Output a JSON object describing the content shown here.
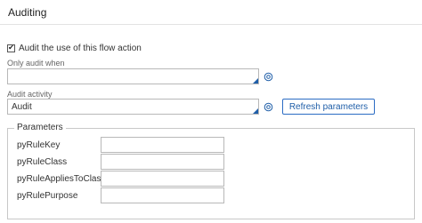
{
  "header": {
    "title": "Auditing"
  },
  "audit_checkbox": {
    "label": "Audit the use of this flow action",
    "checked": true,
    "check_glyph": "✔"
  },
  "only_audit_when": {
    "label": "Only audit when",
    "value": ""
  },
  "audit_activity": {
    "label": "Audit activity",
    "value": "Audit"
  },
  "refresh_button": {
    "label": "Refresh parameters"
  },
  "parameters": {
    "legend": "Parameters",
    "rows": [
      {
        "label": "pyRuleKey",
        "value": ""
      },
      {
        "label": "pyRuleClass",
        "value": ""
      },
      {
        "label": "pyRuleAppliesToClass",
        "value": ""
      },
      {
        "label": "pyRulePurpose",
        "value": ""
      }
    ]
  },
  "colors": {
    "accent": "#1f5ea8",
    "border": "#b8b8b8",
    "divider": "#e3e3e3"
  },
  "icons": {
    "target": "target-icon",
    "corner": "dropdown-corner-icon"
  }
}
